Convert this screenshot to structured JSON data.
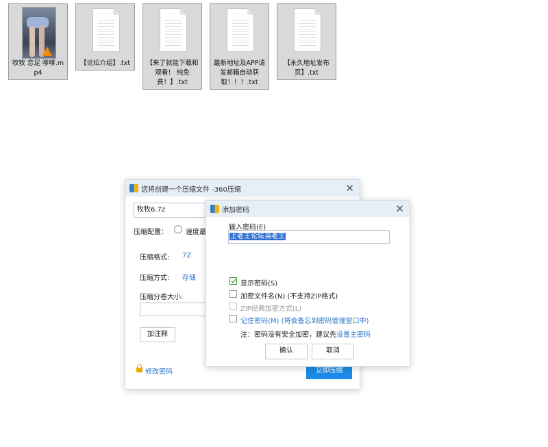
{
  "files": [
    {
      "name": "牧牧 恋足 嗲嗲.mp4",
      "type": "video",
      "icon": "video-thumbnail-icon"
    },
    {
      "name": "【论坛介绍】.txt",
      "type": "text",
      "icon": "text-file-icon"
    },
    {
      "name": "【来了就能下载和观看！ 纯免费！】.txt",
      "type": "text",
      "icon": "text-file-icon"
    },
    {
      "name": "最新地址及APP请发邮箱自动获取！！！.txt",
      "type": "text",
      "icon": "text-file-icon"
    },
    {
      "name": "【永久地址发布页】.txt",
      "type": "text",
      "icon": "text-file-icon"
    }
  ],
  "compress_dialog": {
    "title": "您将创建一个压缩文件 -360压缩",
    "filename": "牧牧6.7z",
    "config_label": "压缩配置：",
    "config_option": "速度最",
    "format_label": "压缩格式:",
    "format_value": "7Z",
    "method_label": "压缩方式:",
    "method_value": "存储",
    "volume_label": "压缩分卷大小:",
    "volume_value": "",
    "comment_button": "加注释",
    "change_password": "修改密码",
    "compress_button": "立即压缩"
  },
  "password_dialog": {
    "title": "添加密码",
    "input_label": "输入密码(E)",
    "password_value": "上老王论坛当老王",
    "show_password": {
      "label": "显示密码(S)",
      "checked": true
    },
    "encrypt_names": {
      "label": "加密文件名(N) (不支持ZIP格式)",
      "checked": false
    },
    "zip_classic": {
      "label": "ZIP经典加密方式(L)",
      "checked": false,
      "disabled": true
    },
    "remember": {
      "label": "记住密码(M) (将会备忘到密码管理窗口中)",
      "checked": false
    },
    "note_text": "注：密码没有安全加密，建议先",
    "note_link": "设置主密码",
    "ok_button": "确认",
    "cancel_button": "取消"
  },
  "colors": {
    "accent": "#1a8ce8",
    "titlebar": "#e6eef8",
    "link": "#2a76c8",
    "selection": "#2f6fd0"
  }
}
